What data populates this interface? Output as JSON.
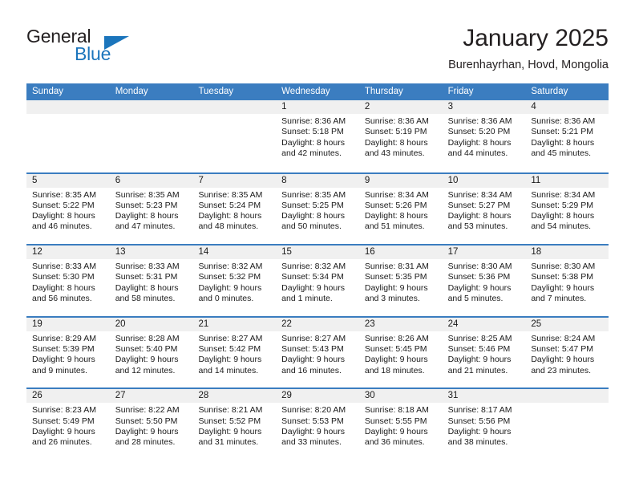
{
  "brand": {
    "name_part1": "General",
    "name_part2": "Blue",
    "accent_color": "#1b75bc"
  },
  "header": {
    "title": "January 2025",
    "subtitle": "Burenhayrhan, Hovd, Mongolia"
  },
  "calendar": {
    "header_color": "#3b7dc0",
    "weekdays": [
      "Sunday",
      "Monday",
      "Tuesday",
      "Wednesday",
      "Thursday",
      "Friday",
      "Saturday"
    ],
    "labels": {
      "sunrise": "Sunrise:",
      "sunset": "Sunset:",
      "daylight": "Daylight:"
    },
    "weeks": [
      [
        {
          "date": "",
          "empty": true
        },
        {
          "date": "",
          "empty": true
        },
        {
          "date": "",
          "empty": true
        },
        {
          "date": "1",
          "sunrise": "Sunrise: 8:36 AM",
          "sunset": "Sunset: 5:18 PM",
          "daylight_1": "Daylight: 8 hours",
          "daylight_2": "and 42 minutes."
        },
        {
          "date": "2",
          "sunrise": "Sunrise: 8:36 AM",
          "sunset": "Sunset: 5:19 PM",
          "daylight_1": "Daylight: 8 hours",
          "daylight_2": "and 43 minutes."
        },
        {
          "date": "3",
          "sunrise": "Sunrise: 8:36 AM",
          "sunset": "Sunset: 5:20 PM",
          "daylight_1": "Daylight: 8 hours",
          "daylight_2": "and 44 minutes."
        },
        {
          "date": "4",
          "sunrise": "Sunrise: 8:36 AM",
          "sunset": "Sunset: 5:21 PM",
          "daylight_1": "Daylight: 8 hours",
          "daylight_2": "and 45 minutes."
        }
      ],
      [
        {
          "date": "5",
          "sunrise": "Sunrise: 8:35 AM",
          "sunset": "Sunset: 5:22 PM",
          "daylight_1": "Daylight: 8 hours",
          "daylight_2": "and 46 minutes."
        },
        {
          "date": "6",
          "sunrise": "Sunrise: 8:35 AM",
          "sunset": "Sunset: 5:23 PM",
          "daylight_1": "Daylight: 8 hours",
          "daylight_2": "and 47 minutes."
        },
        {
          "date": "7",
          "sunrise": "Sunrise: 8:35 AM",
          "sunset": "Sunset: 5:24 PM",
          "daylight_1": "Daylight: 8 hours",
          "daylight_2": "and 48 minutes."
        },
        {
          "date": "8",
          "sunrise": "Sunrise: 8:35 AM",
          "sunset": "Sunset: 5:25 PM",
          "daylight_1": "Daylight: 8 hours",
          "daylight_2": "and 50 minutes."
        },
        {
          "date": "9",
          "sunrise": "Sunrise: 8:34 AM",
          "sunset": "Sunset: 5:26 PM",
          "daylight_1": "Daylight: 8 hours",
          "daylight_2": "and 51 minutes."
        },
        {
          "date": "10",
          "sunrise": "Sunrise: 8:34 AM",
          "sunset": "Sunset: 5:27 PM",
          "daylight_1": "Daylight: 8 hours",
          "daylight_2": "and 53 minutes."
        },
        {
          "date": "11",
          "sunrise": "Sunrise: 8:34 AM",
          "sunset": "Sunset: 5:29 PM",
          "daylight_1": "Daylight: 8 hours",
          "daylight_2": "and 54 minutes."
        }
      ],
      [
        {
          "date": "12",
          "sunrise": "Sunrise: 8:33 AM",
          "sunset": "Sunset: 5:30 PM",
          "daylight_1": "Daylight: 8 hours",
          "daylight_2": "and 56 minutes."
        },
        {
          "date": "13",
          "sunrise": "Sunrise: 8:33 AM",
          "sunset": "Sunset: 5:31 PM",
          "daylight_1": "Daylight: 8 hours",
          "daylight_2": "and 58 minutes."
        },
        {
          "date": "14",
          "sunrise": "Sunrise: 8:32 AM",
          "sunset": "Sunset: 5:32 PM",
          "daylight_1": "Daylight: 9 hours",
          "daylight_2": "and 0 minutes."
        },
        {
          "date": "15",
          "sunrise": "Sunrise: 8:32 AM",
          "sunset": "Sunset: 5:34 PM",
          "daylight_1": "Daylight: 9 hours",
          "daylight_2": "and 1 minute."
        },
        {
          "date": "16",
          "sunrise": "Sunrise: 8:31 AM",
          "sunset": "Sunset: 5:35 PM",
          "daylight_1": "Daylight: 9 hours",
          "daylight_2": "and 3 minutes."
        },
        {
          "date": "17",
          "sunrise": "Sunrise: 8:30 AM",
          "sunset": "Sunset: 5:36 PM",
          "daylight_1": "Daylight: 9 hours",
          "daylight_2": "and 5 minutes."
        },
        {
          "date": "18",
          "sunrise": "Sunrise: 8:30 AM",
          "sunset": "Sunset: 5:38 PM",
          "daylight_1": "Daylight: 9 hours",
          "daylight_2": "and 7 minutes."
        }
      ],
      [
        {
          "date": "19",
          "sunrise": "Sunrise: 8:29 AM",
          "sunset": "Sunset: 5:39 PM",
          "daylight_1": "Daylight: 9 hours",
          "daylight_2": "and 9 minutes."
        },
        {
          "date": "20",
          "sunrise": "Sunrise: 8:28 AM",
          "sunset": "Sunset: 5:40 PM",
          "daylight_1": "Daylight: 9 hours",
          "daylight_2": "and 12 minutes."
        },
        {
          "date": "21",
          "sunrise": "Sunrise: 8:27 AM",
          "sunset": "Sunset: 5:42 PM",
          "daylight_1": "Daylight: 9 hours",
          "daylight_2": "and 14 minutes."
        },
        {
          "date": "22",
          "sunrise": "Sunrise: 8:27 AM",
          "sunset": "Sunset: 5:43 PM",
          "daylight_1": "Daylight: 9 hours",
          "daylight_2": "and 16 minutes."
        },
        {
          "date": "23",
          "sunrise": "Sunrise: 8:26 AM",
          "sunset": "Sunset: 5:45 PM",
          "daylight_1": "Daylight: 9 hours",
          "daylight_2": "and 18 minutes."
        },
        {
          "date": "24",
          "sunrise": "Sunrise: 8:25 AM",
          "sunset": "Sunset: 5:46 PM",
          "daylight_1": "Daylight: 9 hours",
          "daylight_2": "and 21 minutes."
        },
        {
          "date": "25",
          "sunrise": "Sunrise: 8:24 AM",
          "sunset": "Sunset: 5:47 PM",
          "daylight_1": "Daylight: 9 hours",
          "daylight_2": "and 23 minutes."
        }
      ],
      [
        {
          "date": "26",
          "sunrise": "Sunrise: 8:23 AM",
          "sunset": "Sunset: 5:49 PM",
          "daylight_1": "Daylight: 9 hours",
          "daylight_2": "and 26 minutes."
        },
        {
          "date": "27",
          "sunrise": "Sunrise: 8:22 AM",
          "sunset": "Sunset: 5:50 PM",
          "daylight_1": "Daylight: 9 hours",
          "daylight_2": "and 28 minutes."
        },
        {
          "date": "28",
          "sunrise": "Sunrise: 8:21 AM",
          "sunset": "Sunset: 5:52 PM",
          "daylight_1": "Daylight: 9 hours",
          "daylight_2": "and 31 minutes."
        },
        {
          "date": "29",
          "sunrise": "Sunrise: 8:20 AM",
          "sunset": "Sunset: 5:53 PM",
          "daylight_1": "Daylight: 9 hours",
          "daylight_2": "and 33 minutes."
        },
        {
          "date": "30",
          "sunrise": "Sunrise: 8:18 AM",
          "sunset": "Sunset: 5:55 PM",
          "daylight_1": "Daylight: 9 hours",
          "daylight_2": "and 36 minutes."
        },
        {
          "date": "31",
          "sunrise": "Sunrise: 8:17 AM",
          "sunset": "Sunset: 5:56 PM",
          "daylight_1": "Daylight: 9 hours",
          "daylight_2": "and 38 minutes."
        },
        {
          "date": "",
          "empty": true
        }
      ]
    ]
  }
}
